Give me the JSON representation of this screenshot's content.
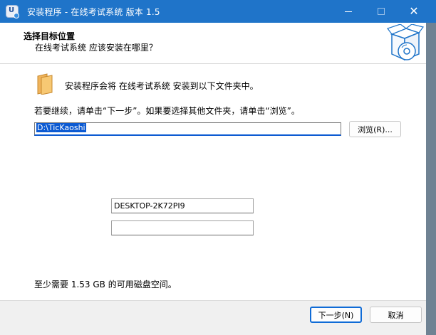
{
  "window": {
    "title": "安装程序 - 在线考试系统 版本 1.5",
    "app_icon_glyph": "U",
    "close_glyph": "✕"
  },
  "header": {
    "title": "选择目标位置",
    "subtitle": "在线考试系统 应该安装在哪里？"
  },
  "body": {
    "intro_text": "安装程序会将 在线考试系统 安装到以下文件夹中。",
    "instruction_text": "若要继续，请单击“下一步”。如果要选择其他文件夹，请单击“浏览”。",
    "install_path": "D:\\TicKaoshi",
    "browse_label": "浏览(R)...",
    "computer_name_value": "DESKTOP-2K72PI9",
    "second_field_value": "",
    "disk_space_text": "至少需要 1.53 GB 的可用磁盘空间。"
  },
  "footer": {
    "next_label": "下一步(N)",
    "cancel_label": "取消"
  },
  "colors": {
    "titlebar": "#1f74c9",
    "accent": "#0c5ad2"
  }
}
